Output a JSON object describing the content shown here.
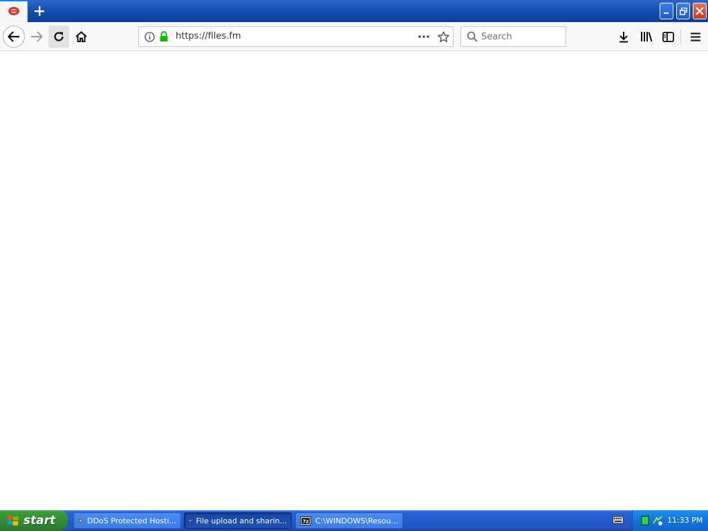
{
  "browser": {
    "address_bar": {
      "url": "https://files.fm"
    },
    "search_bar": {
      "placeholder": "Search"
    }
  },
  "taskbar": {
    "start_label": "start",
    "tasks": [
      {
        "label": "DDoS Protected Hosti..."
      },
      {
        "label": "File upload and sharin..."
      },
      {
        "label": "C:\\WINDOWS\\Resou..."
      }
    ],
    "clock": "11:33 PM"
  }
}
